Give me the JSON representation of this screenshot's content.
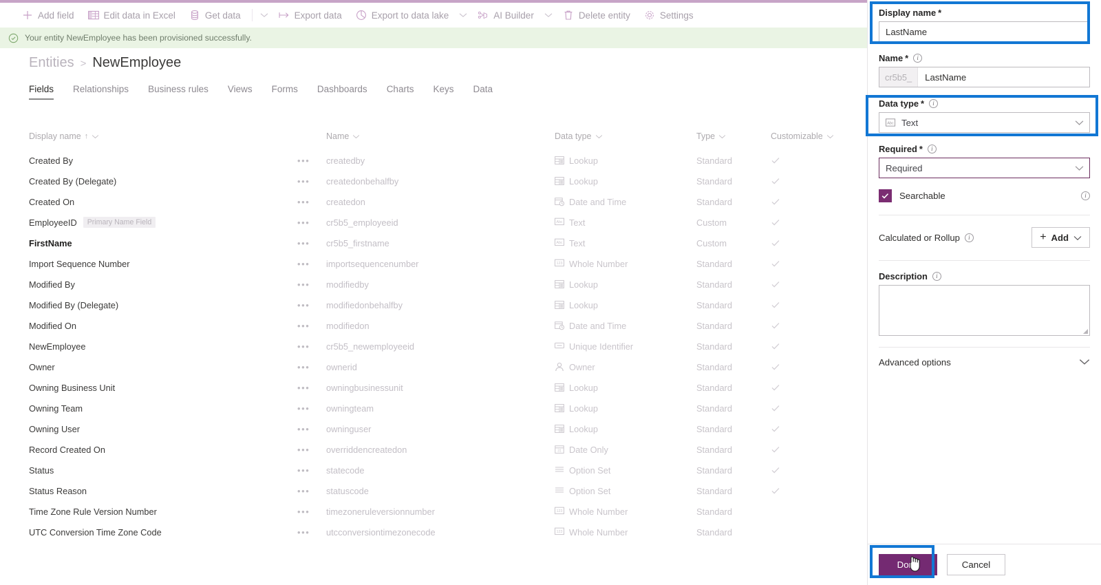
{
  "commandbar": {
    "items": [
      {
        "label": "Add field",
        "icon": "plus-icon",
        "caret": false
      },
      {
        "label": "Edit data in Excel",
        "icon": "excel-icon",
        "caret": false
      },
      {
        "label": "Get data",
        "icon": "database-icon",
        "caret": false
      },
      {
        "label": "",
        "icon": "caret-only",
        "caret": true
      },
      {
        "label": "Export data",
        "icon": "export-arrow-icon",
        "caret": false
      },
      {
        "label": "Export to data lake",
        "icon": "data-lake-icon",
        "caret": true
      },
      {
        "label": "AI Builder",
        "icon": "ai-builder-icon",
        "caret": true
      },
      {
        "label": "Delete entity",
        "icon": "trash-icon",
        "caret": false
      },
      {
        "label": "Settings",
        "icon": "gear-icon",
        "caret": false
      }
    ]
  },
  "banner": {
    "icon": "check-circle-icon",
    "text": "Your entity NewEmployee has been provisioned successfully."
  },
  "breadcrumb": {
    "parent": "Entities",
    "separator": ">",
    "current": "NewEmployee"
  },
  "tabs": [
    {
      "label": "Fields",
      "active": true
    },
    {
      "label": "Relationships",
      "active": false
    },
    {
      "label": "Business rules",
      "active": false
    },
    {
      "label": "Views",
      "active": false
    },
    {
      "label": "Forms",
      "active": false
    },
    {
      "label": "Dashboards",
      "active": false
    },
    {
      "label": "Charts",
      "active": false
    },
    {
      "label": "Keys",
      "active": false
    },
    {
      "label": "Data",
      "active": false
    }
  ],
  "table": {
    "columns": [
      {
        "key": "display_name",
        "label": "Display name",
        "sorted": "asc",
        "sort_glyph": "↑"
      },
      {
        "key": "name",
        "label": "Name"
      },
      {
        "key": "data_type",
        "label": "Data type"
      },
      {
        "key": "type",
        "label": "Type"
      },
      {
        "key": "customizable",
        "label": "Customizable"
      }
    ],
    "rows": [
      {
        "display_name": "Created By",
        "badge": "",
        "bold": false,
        "name": "createdby",
        "data_type": "Lookup",
        "data_type_icon": "lookup-icon",
        "type": "Standard",
        "customizable": true
      },
      {
        "display_name": "Created By (Delegate)",
        "badge": "",
        "bold": false,
        "name": "createdonbehalfby",
        "data_type": "Lookup",
        "data_type_icon": "lookup-icon",
        "type": "Standard",
        "customizable": true
      },
      {
        "display_name": "Created On",
        "badge": "",
        "bold": false,
        "name": "createdon",
        "data_type": "Date and Time",
        "data_type_icon": "date-time-icon",
        "type": "Standard",
        "customizable": true
      },
      {
        "display_name": "EmployeeID",
        "badge": "Primary Name Field",
        "bold": false,
        "name": "cr5b5_employeeid",
        "data_type": "Text",
        "data_type_icon": "text-icon",
        "type": "Custom",
        "customizable": true
      },
      {
        "display_name": "FirstName",
        "badge": "",
        "bold": true,
        "name": "cr5b5_firstname",
        "data_type": "Text",
        "data_type_icon": "text-icon",
        "type": "Custom",
        "customizable": true
      },
      {
        "display_name": "Import Sequence Number",
        "badge": "",
        "bold": false,
        "name": "importsequencenumber",
        "data_type": "Whole Number",
        "data_type_icon": "number-icon",
        "type": "Standard",
        "customizable": true
      },
      {
        "display_name": "Modified By",
        "badge": "",
        "bold": false,
        "name": "modifiedby",
        "data_type": "Lookup",
        "data_type_icon": "lookup-icon",
        "type": "Standard",
        "customizable": true
      },
      {
        "display_name": "Modified By (Delegate)",
        "badge": "",
        "bold": false,
        "name": "modifiedonbehalfby",
        "data_type": "Lookup",
        "data_type_icon": "lookup-icon",
        "type": "Standard",
        "customizable": true
      },
      {
        "display_name": "Modified On",
        "badge": "",
        "bold": false,
        "name": "modifiedon",
        "data_type": "Date and Time",
        "data_type_icon": "date-time-icon",
        "type": "Standard",
        "customizable": true
      },
      {
        "display_name": "NewEmployee",
        "badge": "",
        "bold": false,
        "name": "cr5b5_newemployeeid",
        "data_type": "Unique Identifier",
        "data_type_icon": "unique-id-icon",
        "type": "Standard",
        "customizable": true
      },
      {
        "display_name": "Owner",
        "badge": "",
        "bold": false,
        "name": "ownerid",
        "data_type": "Owner",
        "data_type_icon": "person-icon",
        "type": "Standard",
        "customizable": true
      },
      {
        "display_name": "Owning Business Unit",
        "badge": "",
        "bold": false,
        "name": "owningbusinessunit",
        "data_type": "Lookup",
        "data_type_icon": "lookup-icon",
        "type": "Standard",
        "customizable": true
      },
      {
        "display_name": "Owning Team",
        "badge": "",
        "bold": false,
        "name": "owningteam",
        "data_type": "Lookup",
        "data_type_icon": "lookup-icon",
        "type": "Standard",
        "customizable": true
      },
      {
        "display_name": "Owning User",
        "badge": "",
        "bold": false,
        "name": "owninguser",
        "data_type": "Lookup",
        "data_type_icon": "lookup-icon",
        "type": "Standard",
        "customizable": true
      },
      {
        "display_name": "Record Created On",
        "badge": "",
        "bold": false,
        "name": "overriddencreatedon",
        "data_type": "Date Only",
        "data_type_icon": "date-only-icon",
        "type": "Standard",
        "customizable": true
      },
      {
        "display_name": "Status",
        "badge": "",
        "bold": false,
        "name": "statecode",
        "data_type": "Option Set",
        "data_type_icon": "option-set-icon",
        "type": "Standard",
        "customizable": true
      },
      {
        "display_name": "Status Reason",
        "badge": "",
        "bold": false,
        "name": "statuscode",
        "data_type": "Option Set",
        "data_type_icon": "option-set-icon",
        "type": "Standard",
        "customizable": true
      },
      {
        "display_name": "Time Zone Rule Version Number",
        "badge": "",
        "bold": false,
        "name": "timezoneruleversionnumber",
        "data_type": "Whole Number",
        "data_type_icon": "number-icon",
        "type": "Standard",
        "customizable": false
      },
      {
        "display_name": "UTC Conversion Time Zone Code",
        "badge": "",
        "bold": false,
        "name": "utcconversiontimezonecode",
        "data_type": "Whole Number",
        "data_type_icon": "number-icon",
        "type": "Standard",
        "customizable": false
      }
    ],
    "row_menu_glyph": "•••"
  },
  "panel": {
    "display_name": {
      "label": "Display name",
      "required_mark": "*",
      "value": "LastName"
    },
    "name": {
      "label": "Name",
      "required_mark": "*",
      "prefix": "cr5b5_",
      "value": "LastName"
    },
    "data_type": {
      "label": "Data type",
      "required_mark": "*",
      "value": "Text",
      "icon": "text-icon"
    },
    "required": {
      "label": "Required",
      "required_mark": "*",
      "value": "Required"
    },
    "searchable": {
      "label": "Searchable",
      "checked": true
    },
    "calculated_or_rollup": {
      "label": "Calculated or Rollup",
      "add_label": "Add"
    },
    "description": {
      "label": "Description",
      "value": ""
    },
    "advanced_options": {
      "label": "Advanced options"
    },
    "footer": {
      "done_label": "Done",
      "cancel_label": "Cancel"
    }
  },
  "colors": {
    "accent_purple": "#742a72",
    "checkbox_purple": "#7b2d72",
    "highlight_blue": "#1277d4",
    "banner_green_bg": "#eaf4e4",
    "top_strip": "#c7a4c7"
  }
}
